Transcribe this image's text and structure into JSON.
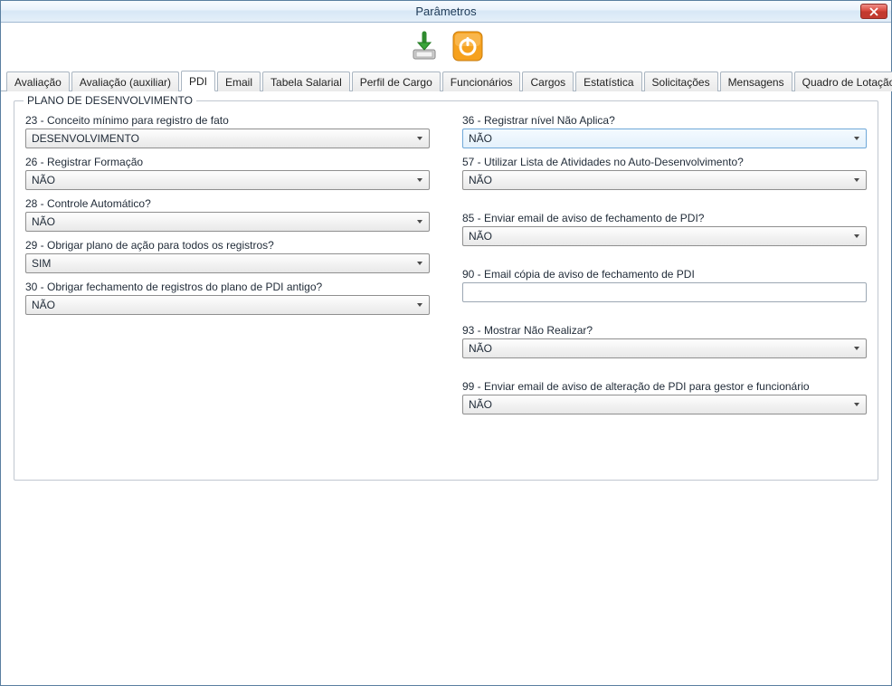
{
  "window": {
    "title": "Parâmetros"
  },
  "tabs": [
    {
      "label": "Avaliação"
    },
    {
      "label": "Avaliação (auxiliar)"
    },
    {
      "label": "PDI"
    },
    {
      "label": "Email"
    },
    {
      "label": "Tabela Salarial"
    },
    {
      "label": "Perfil de Cargo"
    },
    {
      "label": "Funcionários"
    },
    {
      "label": "Cargos"
    },
    {
      "label": "Estatística"
    },
    {
      "label": "Solicitações"
    },
    {
      "label": "Mensagens"
    },
    {
      "label": "Quadro de Lotação"
    }
  ],
  "group": {
    "title": "PLANO DE DESENVOLVIMENTO"
  },
  "left": [
    {
      "label": "23 - Conceito mínimo para registro de fato",
      "value": "DESENVOLVIMENTO",
      "type": "select"
    },
    {
      "label": "26 -  Registrar Formação",
      "value": "NÃO",
      "type": "select"
    },
    {
      "label": "28 - Controle Automático?",
      "value": "NÃO",
      "type": "select"
    },
    {
      "label": "29 - Obrigar plano de ação para todos os registros?",
      "value": "SIM",
      "type": "select"
    },
    {
      "label": "30 - Obrigar fechamento de registros do plano de PDI antigo?",
      "value": "NÃO",
      "type": "select"
    }
  ],
  "right": [
    {
      "label": "36 - Registrar nível Não Aplica?",
      "value": "NÃO",
      "type": "select",
      "highlight": true
    },
    {
      "label": "57 - Utilizar Lista de Atividades no Auto-Desenvolvimento?",
      "value": "NÃO",
      "type": "select"
    },
    {
      "label": "85 - Enviar email de aviso de fechamento de PDI?",
      "value": "NÃO",
      "type": "select",
      "gapBefore": true
    },
    {
      "label": "90 - Email cópia de aviso de fechamento de PDI",
      "value": "",
      "type": "text",
      "gapBefore": true
    },
    {
      "label": "93 - Mostrar Não Realizar?",
      "value": "NÃO",
      "type": "select",
      "gapBefore": true
    },
    {
      "label": "99 - Enviar email de aviso de alteração de PDI para gestor e funcionário",
      "value": "NÃO",
      "type": "select",
      "gapBefore": true
    }
  ]
}
